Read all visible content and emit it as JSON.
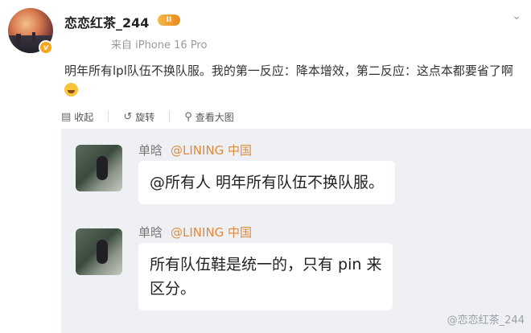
{
  "user": {
    "name": "恋恋红茶_244",
    "rank": "II",
    "verified": "v",
    "source": "来自 iPhone 16 Pro"
  },
  "post": {
    "text": "明年所有lpl队伍不换队服。我的第一反应：降本增效，第二反应：这点本都要省了啊"
  },
  "toolbar": {
    "collapse": "收起",
    "rotate": "旋转",
    "view_large": "查看大图"
  },
  "chat": [
    {
      "sender": "单晗",
      "org": "@LINING 中国",
      "message": "@所有人  明年所有队伍不换队服。"
    },
    {
      "sender": "单晗",
      "org": "@LINING 中国",
      "message_line1": "所有队伍鞋是统一的，只有 pin 来",
      "message_line2": "区分。"
    }
  ],
  "watermark": "@恋恋红茶_244",
  "more_icon": "chevron-down-icon"
}
